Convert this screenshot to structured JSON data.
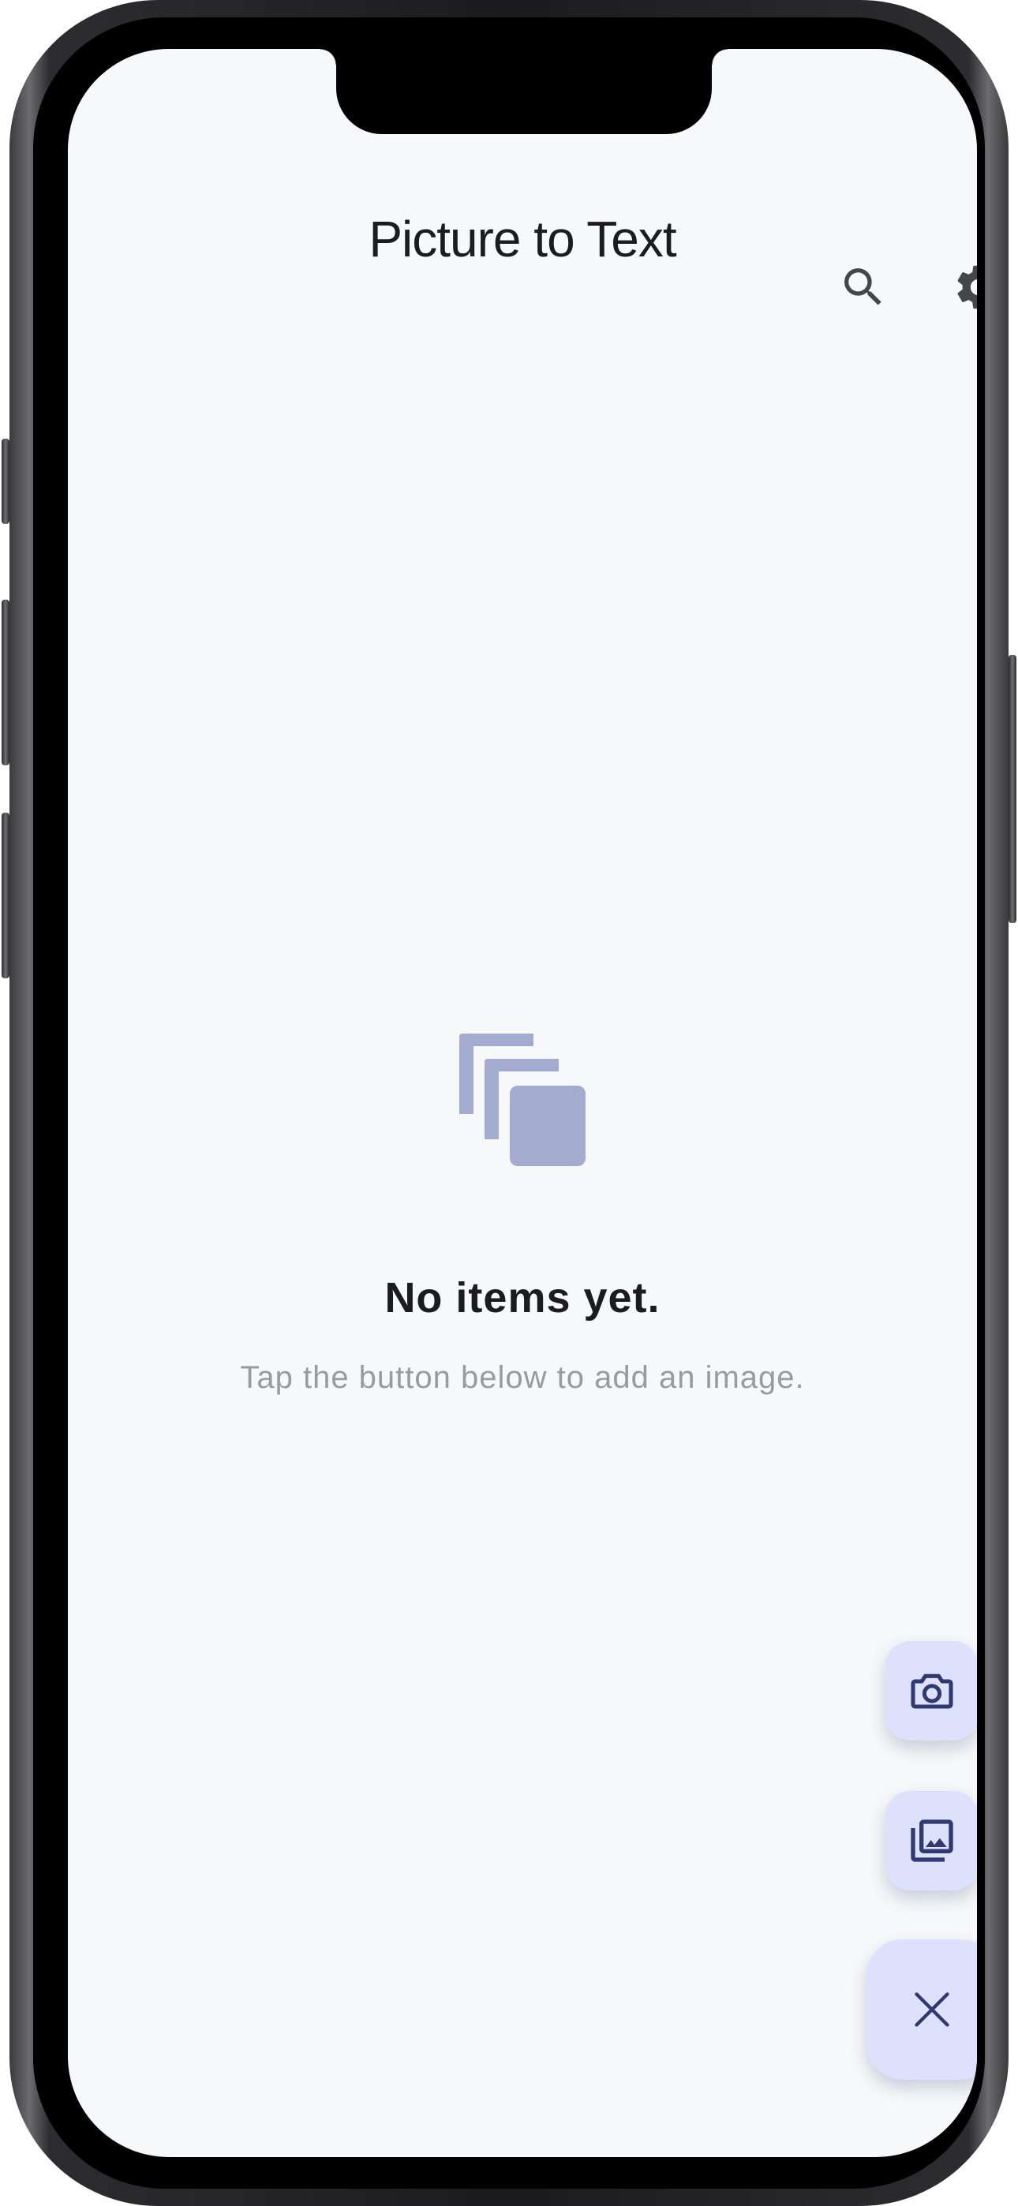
{
  "app": {
    "title": "Picture to Text"
  },
  "header": {
    "search_icon": "search-icon",
    "settings_icon": "gear-icon"
  },
  "empty_state": {
    "icon": "copies-icon",
    "title": "No items yet.",
    "subtitle": "Tap the button below to add an image."
  },
  "fab_menu": {
    "items": [
      {
        "icon": "camera-icon"
      },
      {
        "icon": "photo-library-icon"
      }
    ],
    "toggle_icon": "close-icon"
  },
  "colors": {
    "background": "#f7f8fa",
    "fab_background": "#dde1fb",
    "fab_icon": "#2e3a70",
    "empty_icon": "#a3acce",
    "header_icon": "#45464a"
  }
}
